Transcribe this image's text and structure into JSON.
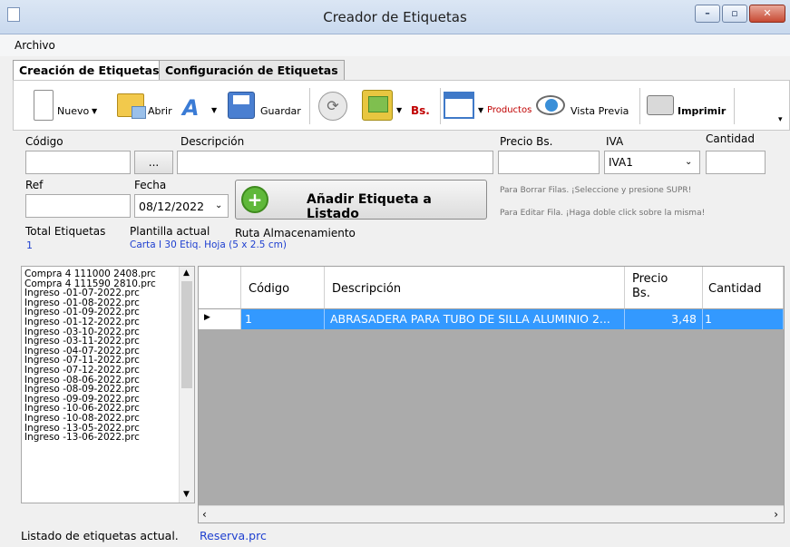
{
  "window": {
    "title": "Creador de Etiquetas",
    "minimize": "–",
    "maximize": "▫",
    "close": "✕"
  },
  "menu": {
    "items": [
      "Archivo"
    ]
  },
  "tabs": [
    {
      "label": "Creación de Etiquetas",
      "active": true
    },
    {
      "label": "Configuración de Etiquetas",
      "active": false
    }
  ],
  "toolbar": {
    "new": "Nuevo",
    "open": "Abrir",
    "save": "Guardar",
    "currency": "Bs.",
    "products": "Productos",
    "preview": "Vista Previa",
    "print": "Imprimir"
  },
  "form": {
    "codigo_label": "Código",
    "codigo_value": "",
    "browse_button": "...",
    "descripcion_label": "Descripción",
    "descripcion_value": "",
    "precio_label": "Precio Bs.",
    "precio_value": "",
    "iva_label": "IVA",
    "iva_value": "IVA1",
    "cantidad_label": "Cantidad",
    "cantidad_value": "",
    "ref_label": "Ref",
    "ref_value": "",
    "fecha_label": "Fecha",
    "fecha_value": "08/12/2022",
    "add_button": "Añadir Etiqueta a Listado",
    "hint_delete": "Para Borrar Filas. ¡Seleccione y presione SUPR!",
    "hint_edit": "Para Editar Fila. ¡Haga doble click sobre la misma!",
    "total_label": "Total Etiquetas",
    "total_value": "1",
    "plantilla_label": "Plantilla actual",
    "plantilla_value": "Carta I 30 Etiq. Hoja (5 x 2.5 cm)",
    "ruta_label": "Ruta Almacenamiento"
  },
  "files": [
    "Compra 4 111000 2408.prc",
    "Compra 4 111590 2810.prc",
    "Ingreso -01-07-2022.prc",
    "Ingreso -01-08-2022.prc",
    "Ingreso -01-09-2022.prc",
    "Ingreso -01-12-2022.prc",
    "Ingreso -03-10-2022.prc",
    "Ingreso -03-11-2022.prc",
    "Ingreso -04-07-2022.prc",
    "Ingreso -07-11-2022.prc",
    "Ingreso -07-12-2022.prc",
    "Ingreso -08-06-2022.prc",
    "Ingreso -08-09-2022.prc",
    "Ingreso -09-09-2022.prc",
    "Ingreso -10-06-2022.prc",
    "Ingreso -10-08-2022.prc",
    "Ingreso -13-05-2022.prc",
    "Ingreso -13-06-2022.prc"
  ],
  "grid": {
    "columns": [
      "Código",
      "Descripción",
      "Precio Bs.",
      "Cantidad"
    ],
    "rows": [
      {
        "codigo": "1",
        "descripcion": "ABRASADERA PARA TUBO DE SILLA ALUMINIO 2...",
        "precio": "3,48",
        "cantidad": "1"
      }
    ]
  },
  "footer": {
    "label": "Listado de etiquetas actual.",
    "value": "Reserva.prc"
  },
  "colors": {
    "selection": "#3399ff",
    "link": "#1f40d0"
  }
}
